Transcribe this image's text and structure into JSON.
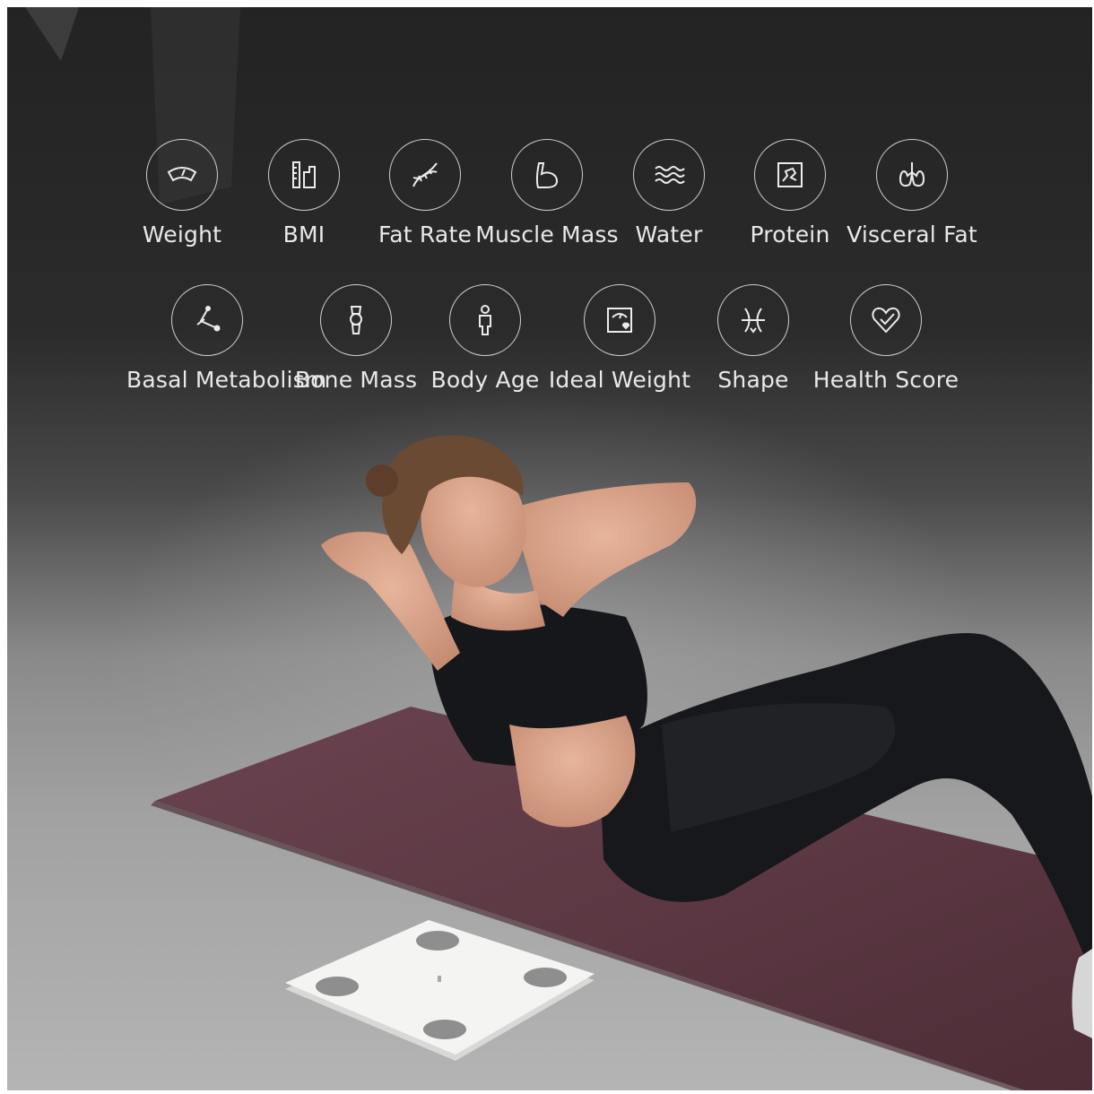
{
  "metrics_row_1": [
    {
      "label": "Weight",
      "icon": "scale-dial-icon"
    },
    {
      "label": "BMI",
      "icon": "bmi-ruler-icon"
    },
    {
      "label": "Fat Rate",
      "icon": "dna-icon"
    },
    {
      "label": "Muscle Mass",
      "icon": "flexed-arm-icon"
    },
    {
      "label": "Water",
      "icon": "water-waves-icon"
    },
    {
      "label": "Protein",
      "icon": "protein-icon"
    },
    {
      "label": "Visceral Fat",
      "icon": "lungs-icon"
    }
  ],
  "metrics_row_2": [
    {
      "label": "Basal Metabolism",
      "icon": "metabolism-icon"
    },
    {
      "label": "Bone Mass",
      "icon": "bone-icon"
    },
    {
      "label": "Body Age",
      "icon": "person-icon"
    },
    {
      "label": "Ideal Weight",
      "icon": "ideal-weight-icon"
    },
    {
      "label": "Shape",
      "icon": "body-shape-icon"
    },
    {
      "label": "Health Score",
      "icon": "heart-check-icon"
    }
  ],
  "colors": {
    "icon_stroke": "#ececec",
    "mat": "#5e3a44",
    "outfit": "#16171b",
    "skin": "#d9a58c",
    "scale_body": "#f4f4f2",
    "scale_pad": "#8e8e8e"
  }
}
